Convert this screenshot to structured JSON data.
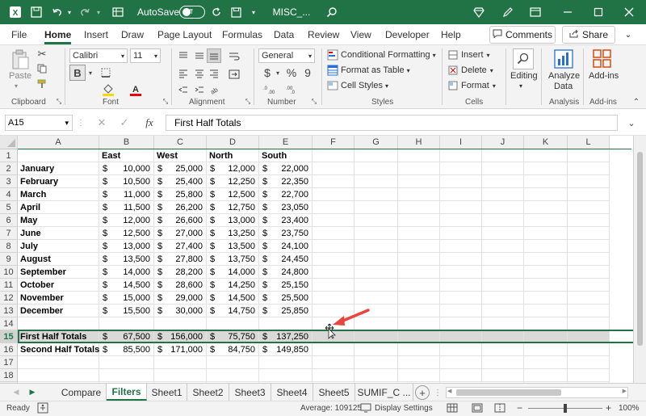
{
  "window": {
    "autosave_label": "AutoSave",
    "autosave_state": "Off",
    "filename": "MISC_...",
    "accent_color": "#217346"
  },
  "tabs": [
    "File",
    "Home",
    "Insert",
    "Draw",
    "Page Layout",
    "Formulas",
    "Data",
    "Review",
    "View",
    "Developer",
    "Help"
  ],
  "active_tab": "Home",
  "comments_label": "Comments",
  "share_label": "Share",
  "ribbon": {
    "paste": "Paste",
    "clipboard": "Clipboard",
    "font_name": "Calibri",
    "font_size": "11",
    "font": "Font",
    "alignment": "Alignment",
    "number_format": "General",
    "currency_sym": "$",
    "percent_sym": "%",
    "comma_sym": "9",
    "number": "Number",
    "cond_format": "Conditional Formatting",
    "format_table": "Format as Table",
    "cell_styles": "Cell Styles",
    "styles": "Styles",
    "insert": "Insert",
    "delete": "Delete",
    "format": "Format",
    "cells": "Cells",
    "editing": "Editing",
    "analyze_line1": "Analyze",
    "analyze_line2": "Data",
    "analysis": "Analysis",
    "addins": "Add-ins",
    "addins_group": "Add-ins"
  },
  "formula_bar": {
    "name_box": "A15",
    "fx": "fx",
    "content": "First Half Totals"
  },
  "columns": [
    "A",
    "B",
    "C",
    "D",
    "E",
    "F",
    "G",
    "H",
    "I",
    "J",
    "K",
    "L"
  ],
  "headers": {
    "b": "East",
    "c": "West",
    "d": "North",
    "e": "South"
  },
  "rows": [
    {
      "n": "1",
      "label": "",
      "vals": [
        "East",
        "West",
        "North",
        "South"
      ],
      "header": true
    },
    {
      "n": "2",
      "label": "January",
      "vals": [
        "10,000",
        "25,000",
        "12,000",
        "22,000"
      ]
    },
    {
      "n": "3",
      "label": "February",
      "vals": [
        "10,500",
        "25,400",
        "12,250",
        "22,350"
      ]
    },
    {
      "n": "4",
      "label": "March",
      "vals": [
        "11,000",
        "25,800",
        "12,500",
        "22,700"
      ]
    },
    {
      "n": "5",
      "label": "April",
      "vals": [
        "11,500",
        "26,200",
        "12,750",
        "23,050"
      ]
    },
    {
      "n": "6",
      "label": "May",
      "vals": [
        "12,000",
        "26,600",
        "13,000",
        "23,400"
      ]
    },
    {
      "n": "7",
      "label": "June",
      "vals": [
        "12,500",
        "27,000",
        "13,250",
        "23,750"
      ]
    },
    {
      "n": "8",
      "label": "July",
      "vals": [
        "13,000",
        "27,400",
        "13,500",
        "24,100"
      ]
    },
    {
      "n": "9",
      "label": "August",
      "vals": [
        "13,500",
        "27,800",
        "13,750",
        "24,450"
      ]
    },
    {
      "n": "10",
      "label": "September",
      "vals": [
        "14,000",
        "28,200",
        "14,000",
        "24,800"
      ]
    },
    {
      "n": "11",
      "label": "October",
      "vals": [
        "14,500",
        "28,600",
        "14,250",
        "25,150"
      ]
    },
    {
      "n": "12",
      "label": "November",
      "vals": [
        "15,000",
        "29,000",
        "14,500",
        "25,500"
      ]
    },
    {
      "n": "13",
      "label": "December",
      "vals": [
        "15,500",
        "30,000",
        "14,750",
        "25,850"
      ]
    },
    {
      "n": "14",
      "label": "",
      "vals": [
        "",
        "",
        "",
        ""
      ],
      "empty": true
    },
    {
      "n": "15",
      "label": "First Half Totals",
      "vals": [
        "67,500",
        "156,000",
        "75,750",
        "137,250"
      ],
      "selected": true
    },
    {
      "n": "16",
      "label": "Second Half Totals",
      "vals": [
        "85,500",
        "171,000",
        "84,750",
        "149,850"
      ]
    },
    {
      "n": "17",
      "label": "",
      "vals": [
        "",
        "",
        "",
        ""
      ],
      "empty": true
    },
    {
      "n": "18",
      "label": "",
      "vals": [
        "",
        "",
        "",
        ""
      ],
      "empty": true
    },
    {
      "n": "19",
      "label": "",
      "vals": [
        "",
        "",
        "",
        ""
      ],
      "empty": true
    }
  ],
  "currency": "$",
  "sheets": [
    "Compare",
    "Filters",
    "Sheet1",
    "Sheet2",
    "Sheet3",
    "Sheet4",
    "Sheet5",
    "SUMIF_C ..."
  ],
  "active_sheet": "Filters",
  "status": {
    "ready": "Ready",
    "average": "Average: 109125",
    "display_settings": "Display Settings",
    "zoom": "100%"
  }
}
